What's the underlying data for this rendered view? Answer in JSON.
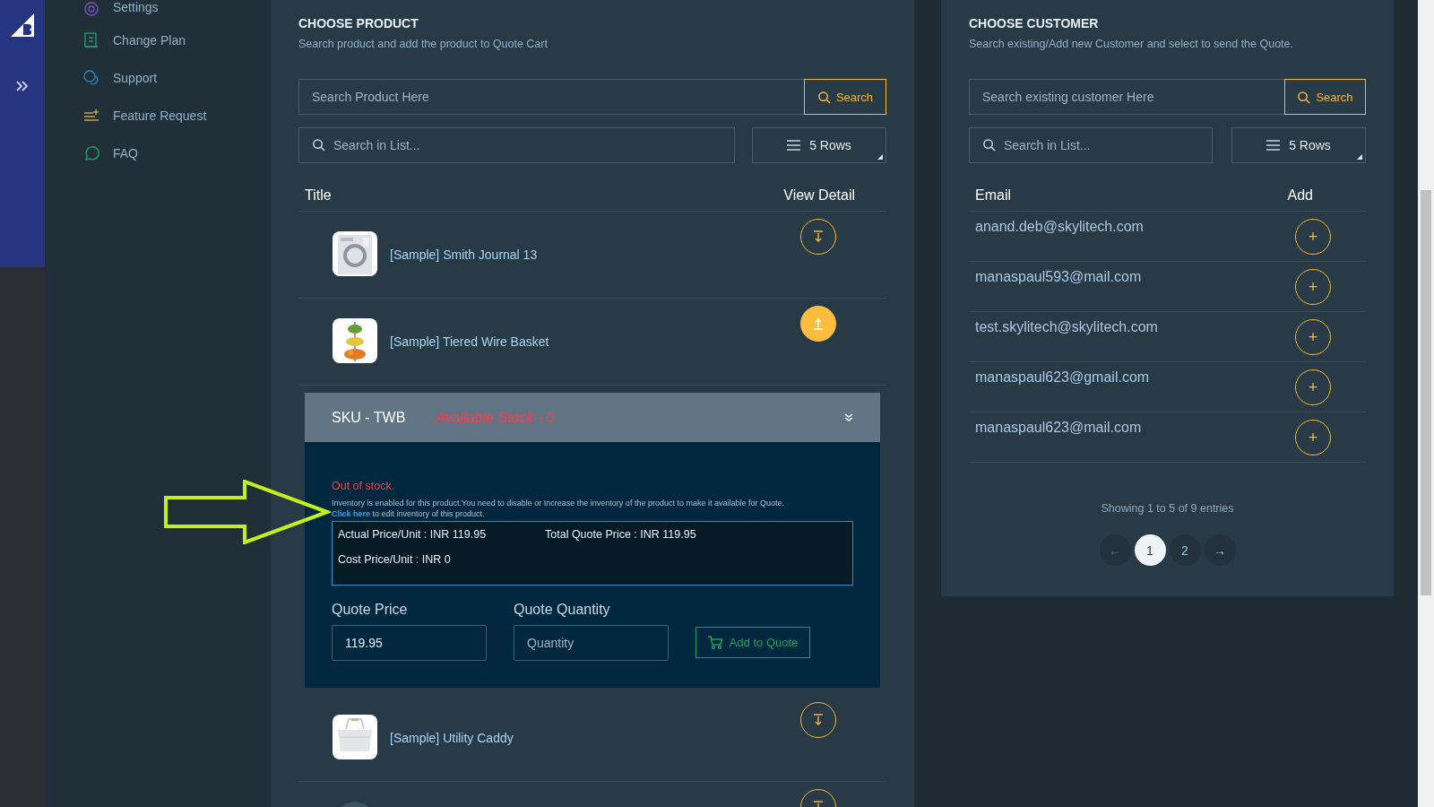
{
  "sidebar": {
    "items": [
      {
        "label": "Settings"
      },
      {
        "label": "Change Plan"
      },
      {
        "label": "Support"
      },
      {
        "label": "Feature Request"
      },
      {
        "label": "FAQ"
      }
    ]
  },
  "products": {
    "title": "CHOOSE PRODUCT",
    "subtitle": "Search product and add the product to Quote Cart",
    "search": {
      "placeholder": "Search Product Here",
      "button": "Search"
    },
    "list_search": {
      "placeholder": "Search in List..."
    },
    "rows_select": "5 Rows",
    "columns": [
      "Title",
      "View Detail"
    ],
    "rows": [
      {
        "title": "[Sample] Smith Journal 13",
        "expanded": false
      },
      {
        "title": "[Sample] Tiered Wire Basket",
        "expanded": true
      },
      {
        "title": "[Sample] Utility Caddy",
        "expanded": false
      },
      {
        "expanded": false
      }
    ],
    "detail": {
      "sku": "SKU - TWB",
      "stock": "Available Stock - 0",
      "status": "Out of stock.",
      "note": "Inventory is enabled for this product.You need to disable or Increase the inventory of the product to make it available for Quote.",
      "link": "Click here",
      "link_rest": "to edit inventory of this product.",
      "actual_price": "Actual Price/Unit : INR 119.95",
      "total_price": "Total Quote Price : INR 119.95",
      "cost_price": "Cost Price/Unit : INR 0",
      "quote_price_label": "Quote Price",
      "quote_price_value": "119.95",
      "quantity_label": "Quote Quantity",
      "quantity_placeholder": "Quantity",
      "add_button": "Add to Quote"
    }
  },
  "customers": {
    "title": "CHOOSE CUSTOMER",
    "subtitle": "Search existing/Add new Customer and select to send the Quote.",
    "search": {
      "placeholder": "Search existing customer Here",
      "button": "Search"
    },
    "list_search": {
      "placeholder": "Search in List..."
    },
    "rows_select": "5 Rows",
    "columns": [
      "Email",
      "Add"
    ],
    "rows": [
      {
        "email": "anand.deb@skylitech.com",
        "add": "+"
      },
      {
        "email": "manaspaul593@mail.com",
        "add": "+"
      },
      {
        "email": "test.skylitech@skylitech.com",
        "add": "+"
      },
      {
        "email": "manaspaul623@gmail.com",
        "add": "+"
      },
      {
        "email": "manaspaul623@mail.com",
        "add": "+"
      }
    ],
    "info": "Showing 1 to 5 of 9 entries",
    "pagination": {
      "prev": "←",
      "pages": [
        {
          "label": "1",
          "selected": true
        },
        {
          "label": "2",
          "selected": false
        }
      ],
      "next": "→"
    }
  }
}
